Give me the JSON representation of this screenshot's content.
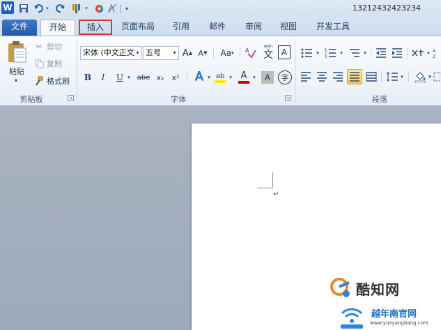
{
  "window": {
    "title": "13212432423234"
  },
  "qat": {
    "logo_letter": "W"
  },
  "tabs": {
    "file": "文件",
    "home": "开始",
    "insert": "插入",
    "layout": "页面布局",
    "references": "引用",
    "mailings": "邮件",
    "review": "审阅",
    "view": "视图",
    "developer": "开发工具"
  },
  "clipboard": {
    "paste": "粘贴",
    "cut": "剪切",
    "copy": "复制",
    "format_painter": "格式刷",
    "group_label": "剪贴板"
  },
  "font": {
    "font_name": "宋体 (中文正文",
    "font_size": "五号",
    "grow": "A",
    "shrink": "A",
    "change_case": "Aa",
    "phonetic": "文",
    "enclose": "A",
    "bold": "B",
    "italic": "I",
    "underline": "U",
    "strike": "abe",
    "subscript": "x₂",
    "superscript": "x²",
    "effects": "A",
    "highlight": "ab",
    "font_color": "A",
    "shading": "A",
    "enclosed_char": "字",
    "group_label": "字体"
  },
  "paragraph": {
    "group_label": "段落"
  },
  "document": {
    "para_mark": "↵"
  },
  "watermark": {
    "title": "酷知网",
    "subtitle": "越年南官网",
    "url": "www.yueyangbang.com"
  },
  "colors": {
    "accent_red": "#d23a3a",
    "highlight": "#ffe800",
    "font_red": "#d40000",
    "file_tab": "#2e66b8"
  }
}
